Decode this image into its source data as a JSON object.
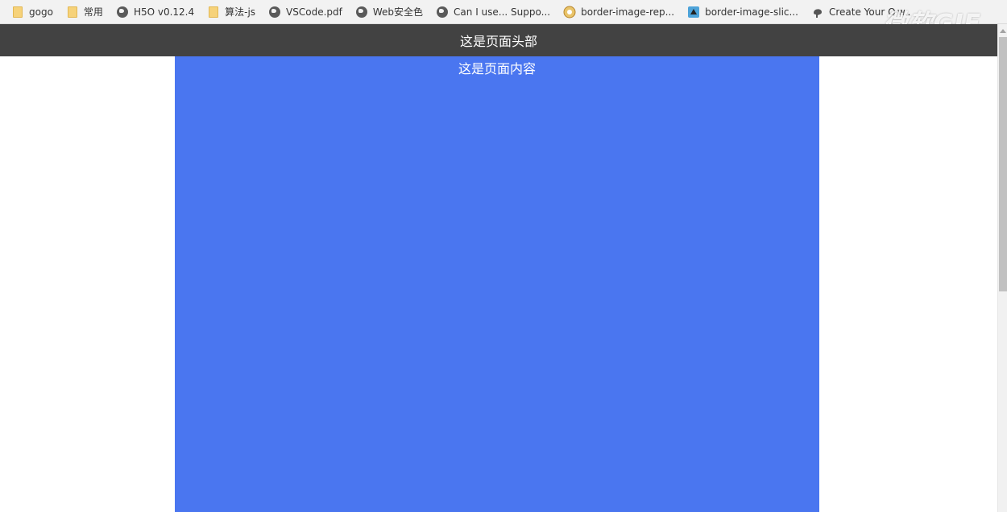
{
  "bookmarks": [
    {
      "label": "gogo",
      "icon": "folder-icon"
    },
    {
      "label": "常用",
      "icon": "folder-icon"
    },
    {
      "label": "H5O v0.12.4",
      "icon": "globe-icon"
    },
    {
      "label": "算法-js",
      "icon": "folder-icon"
    },
    {
      "label": "VSCode.pdf",
      "icon": "globe-icon"
    },
    {
      "label": "Web安全色",
      "icon": "globe-icon"
    },
    {
      "label": "Can I use... Suppo...",
      "icon": "globe-icon"
    },
    {
      "label": "border-image-rep...",
      "icon": "site-icon"
    },
    {
      "label": "border-image-slic...",
      "icon": "site-icon"
    },
    {
      "label": "Create Your O w..",
      "icon": "site-icon"
    }
  ],
  "watermark": "微软GIF",
  "page": {
    "header_text": "这是页面头部",
    "content_text": "这是页面内容"
  },
  "colors": {
    "header_bg": "#424242",
    "content_bg": "#4a76f0"
  }
}
